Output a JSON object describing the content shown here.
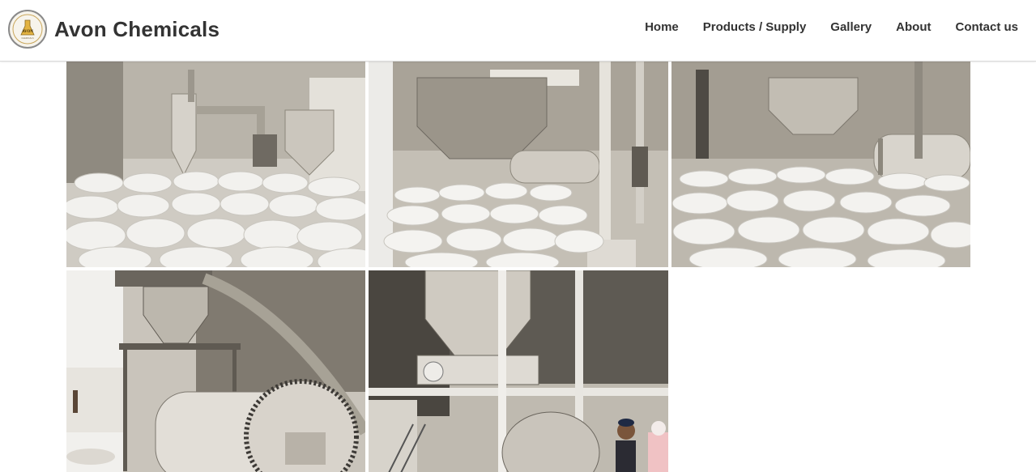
{
  "brand": {
    "name": "Avon Chemicals",
    "logo_text": "AVON",
    "logo_subtext": "CHEMICALS",
    "logo_icon": "flask-icon"
  },
  "nav": {
    "items": [
      {
        "label": "Home"
      },
      {
        "label": "Products / Supply"
      },
      {
        "label": "Gallery"
      },
      {
        "label": "About"
      },
      {
        "label": "Contact us"
      }
    ]
  },
  "gallery": {
    "images": [
      {
        "subject": "bagged-powder-cyclone-photo"
      },
      {
        "subject": "bagged-powder-silo-photo"
      },
      {
        "subject": "bagged-powder-ball-mill-photo"
      },
      {
        "subject": "ball-mill-hopper-photo"
      },
      {
        "subject": "hopper-ball-mill-workers-photo"
      }
    ]
  },
  "colors": {
    "text": "#333333",
    "border": "#d9d9d9",
    "background": "#ffffff"
  }
}
